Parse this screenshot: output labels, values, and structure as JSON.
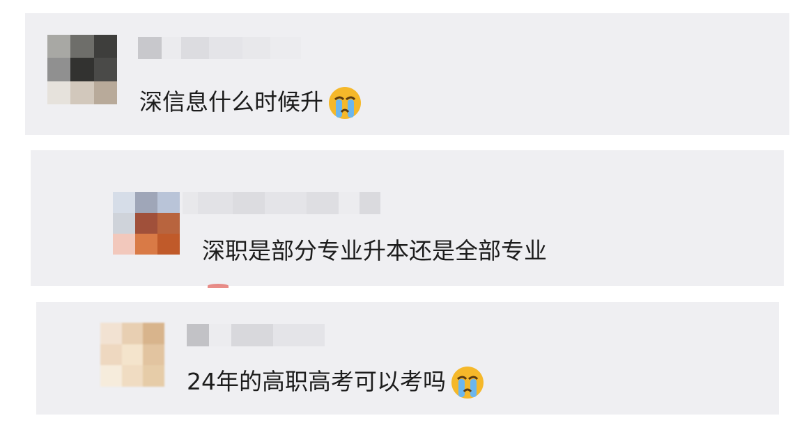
{
  "comments": [
    {
      "text": "深信息什么时候升",
      "emoji": "crying-face-icon"
    },
    {
      "text": "深职是部分专业升本还是全部专业",
      "emoji": null
    },
    {
      "text": "24年的高职高考可以考吗",
      "emoji": "crying-face-icon"
    }
  ],
  "colors": {
    "card_bg": "#efeff2",
    "text": "#1c1c1c",
    "emoji_face": "#f5b82a"
  }
}
